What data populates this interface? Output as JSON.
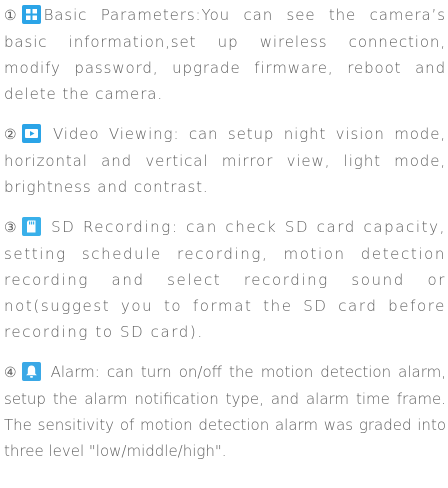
{
  "items": [
    {
      "number": "①",
      "icon": "grid-settings-icon",
      "text": "Basic Parameters:You can see the camera’s basic information,set up wireless connection, modify password, upgrade firmware, reboot and delete the camera."
    },
    {
      "number": "②",
      "icon": "play-video-icon",
      "text": " Video Viewing: can setup night vision mode, horizontal and vertical mirror view, light mode, brightness and contrast."
    },
    {
      "number": "③",
      "icon": "sd-card-icon",
      "text": " SD Recording: can check SD card capacity, setting schedule recording, motion detection recording and select recording sound or not(suggest you to format the SD card before recording to SD card)."
    },
    {
      "number": "④",
      "icon": "alarm-bell-icon",
      "text": " Alarm: can turn on/off the motion detection alarm, setup the alarm notification type, and alarm time frame. The sensitivity of motion detection alarm was graded into three level \"low/middle/high\"."
    }
  ],
  "colors": {
    "text": "#5f5f5f",
    "icon_blue": "#2ba4e7"
  }
}
